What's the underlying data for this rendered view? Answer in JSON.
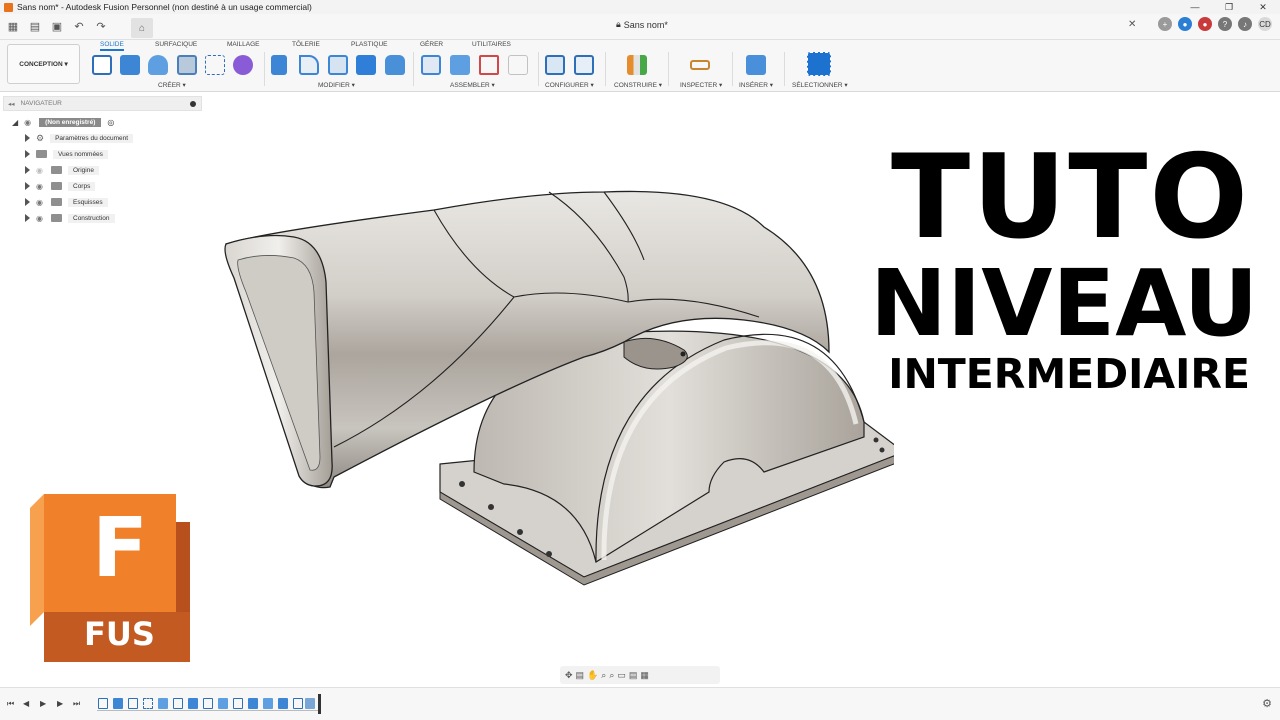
{
  "window": {
    "title": "Sans nom* - Autodesk Fusion Personnel (non destiné à un usage commercial)",
    "controls": [
      "—",
      "❐",
      "✕"
    ]
  },
  "document": {
    "tab_title": "Sans nom*"
  },
  "ribbon": {
    "workspace": "CONCEPTION ▾",
    "tabs": [
      "SOLIDE",
      "SURFACIQUE",
      "MAILLAGE",
      "TÔLERIE",
      "PLASTIQUE",
      "GÉRER",
      "UTILITAIRES"
    ],
    "groups": [
      "CRÉER ▾",
      "MODIFIER ▾",
      "ASSEMBLER ▾",
      "CONFIGURER ▾",
      "CONSTRUIRE ▾",
      "INSPECTER ▾",
      "INSÉRER ▾",
      "SÉLECTIONNER ▾"
    ]
  },
  "navigator": {
    "title": "NAVIGATEUR",
    "root": "(Non enregistré)",
    "items": [
      "Paramètres du document",
      "Vues nommées",
      "Origine",
      "Corps",
      "Esquisses",
      "Construction"
    ]
  },
  "overlay": {
    "line1": "TUTO",
    "line2": "NIVEAU",
    "line3": "INTERMEDIAIRE"
  },
  "logo": {
    "letter": "F",
    "label": "FUS"
  },
  "colors": {
    "accent": "#1f75c7",
    "logo_orange": "#f0802a",
    "logo_dark": "#b8501d",
    "model_gray": "#c9c6c1"
  }
}
